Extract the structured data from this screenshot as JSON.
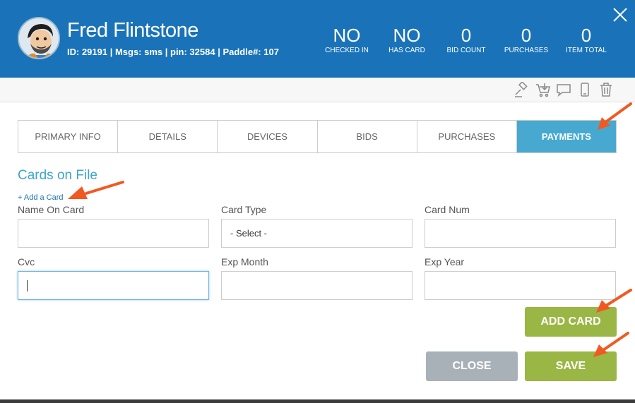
{
  "user": {
    "name": "Fred Flintstone",
    "meta": "ID: 29191 | Msgs: sms | pin: 32584 | Paddle#: 107"
  },
  "stats": [
    {
      "value": "NO",
      "label": "CHECKED IN"
    },
    {
      "value": "NO",
      "label": "HAS CARD"
    },
    {
      "value": "0",
      "label": "BID COUNT"
    },
    {
      "value": "0",
      "label": "PURCHASES"
    },
    {
      "value": "0",
      "label": "ITEM TOTAL"
    }
  ],
  "toolbar": {
    "icons": [
      "gavel-icon",
      "cart-icon",
      "chat-icon",
      "phone-icon",
      "trash-icon"
    ]
  },
  "tabs": [
    {
      "label": "PRIMARY INFO",
      "active": false
    },
    {
      "label": "DETAILS",
      "active": false
    },
    {
      "label": "DEVICES",
      "active": false
    },
    {
      "label": "BIDS",
      "active": false
    },
    {
      "label": "PURCHASES",
      "active": false
    },
    {
      "label": "PAYMENTS",
      "active": true
    }
  ],
  "cards": {
    "title": "Cards on File",
    "add_link": "+ Add a Card",
    "fields": {
      "name_on_card": {
        "label": "Name On Card",
        "value": ""
      },
      "card_type": {
        "label": "Card Type",
        "value": "- Select -"
      },
      "card_num": {
        "label": "Card Num",
        "value": ""
      },
      "cvc": {
        "label": "Cvc",
        "value": ""
      },
      "exp_month": {
        "label": "Exp Month",
        "value": ""
      },
      "exp_year": {
        "label": "Exp Year",
        "value": ""
      }
    }
  },
  "buttons": {
    "add_card": "ADD CARD",
    "close": "CLOSE",
    "save": "SAVE"
  },
  "colors": {
    "header": "#1a73b8",
    "active_tab": "#47a9cf",
    "green_button": "#9ab645",
    "grey_button": "#a7b1b7",
    "annotation_arrow": "#f05a22"
  }
}
